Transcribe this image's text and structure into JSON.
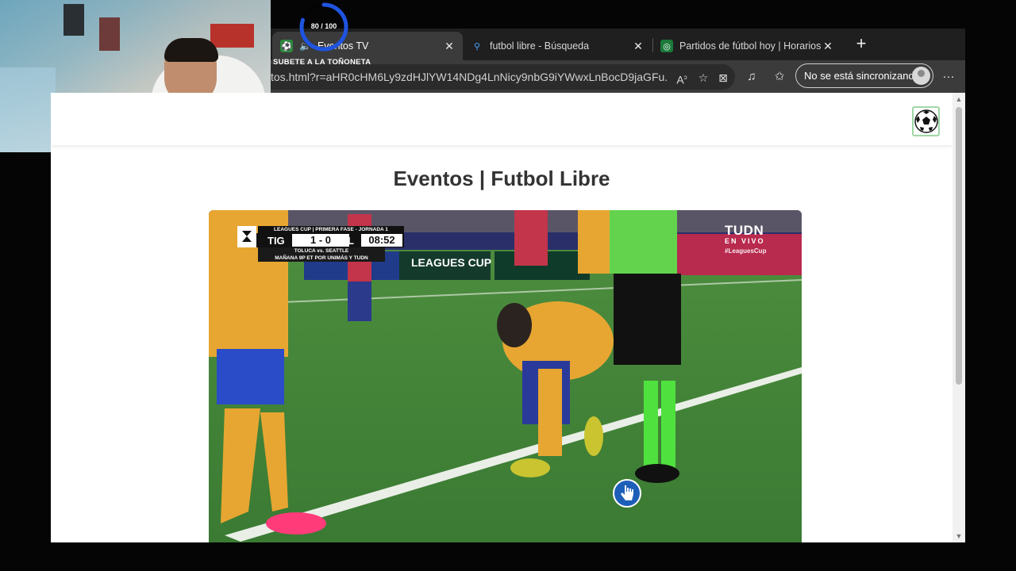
{
  "browser": {
    "tabs": [
      {
        "title": "Eventos TV",
        "active": true
      },
      {
        "title": "futbol libre - Búsqueda",
        "active": false
      },
      {
        "title": "Partidos de fútbol hoy | Horarios y",
        "active": false
      }
    ],
    "address": "tos.html?r=aHR0cHM6Ly9zdHJlYW14NDg4LnNicy9nbG9iYWwxLnBocD9jaGFu...",
    "sync_label": "No se está sincronizando"
  },
  "overlay": {
    "progress_label": "80 / 100",
    "progress_value": 0.8,
    "progress_color": "#1f54e0",
    "promo_text": "SUBETE A LA TOÑONETA"
  },
  "page": {
    "title": "Eventos | Futbol Libre"
  },
  "video": {
    "scoreboard": {
      "header": "LEAGUES CUP | PRIMERA FASE - JORNADA 1",
      "home": "TIG",
      "result": "1 - 0",
      "away": "RSL",
      "clock": "08:52",
      "line1": "TOLUCA vs. SEATTLE",
      "line2": "MAÑANA 9P ET POR UNIMÁS Y TUDN"
    },
    "broadcaster": {
      "name": "TUDN",
      "live": "EN VIVO",
      "hashtag": "#LeaguesCup"
    },
    "board_text": "LEAGUES CUP"
  }
}
